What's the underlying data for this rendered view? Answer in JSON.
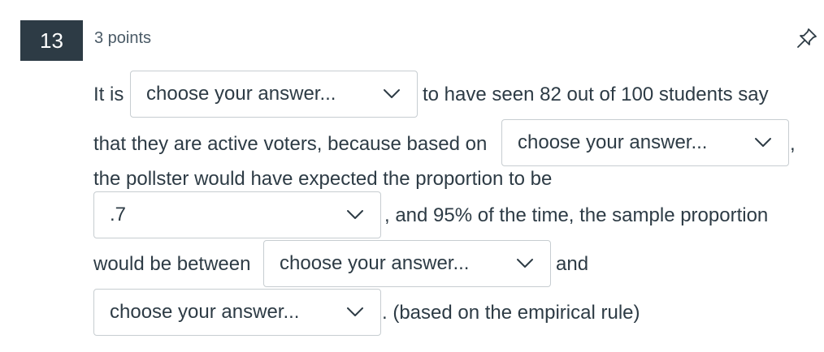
{
  "question": {
    "number": "13",
    "points": "3 points",
    "pin_icon": "pin-icon"
  },
  "text": {
    "seg1": "It is",
    "seg2": "to have seen 82 out of 100 students say",
    "seg3": "that they are active voters, because based on",
    "seg4": ",",
    "seg5": "the pollster would have expected the proportion to be",
    "seg6": ", and 95% of the time, the sample proportion",
    "seg7": "would be between",
    "seg8": "and",
    "seg9": ". (based on the empirical rule)"
  },
  "dropdowns": {
    "d1": "choose your answer...",
    "d2": "choose your answer...",
    "d3": ".7",
    "d4": "choose your answer...",
    "d5": "choose your answer..."
  },
  "icons": {
    "chevron": "chevron-down-icon"
  }
}
